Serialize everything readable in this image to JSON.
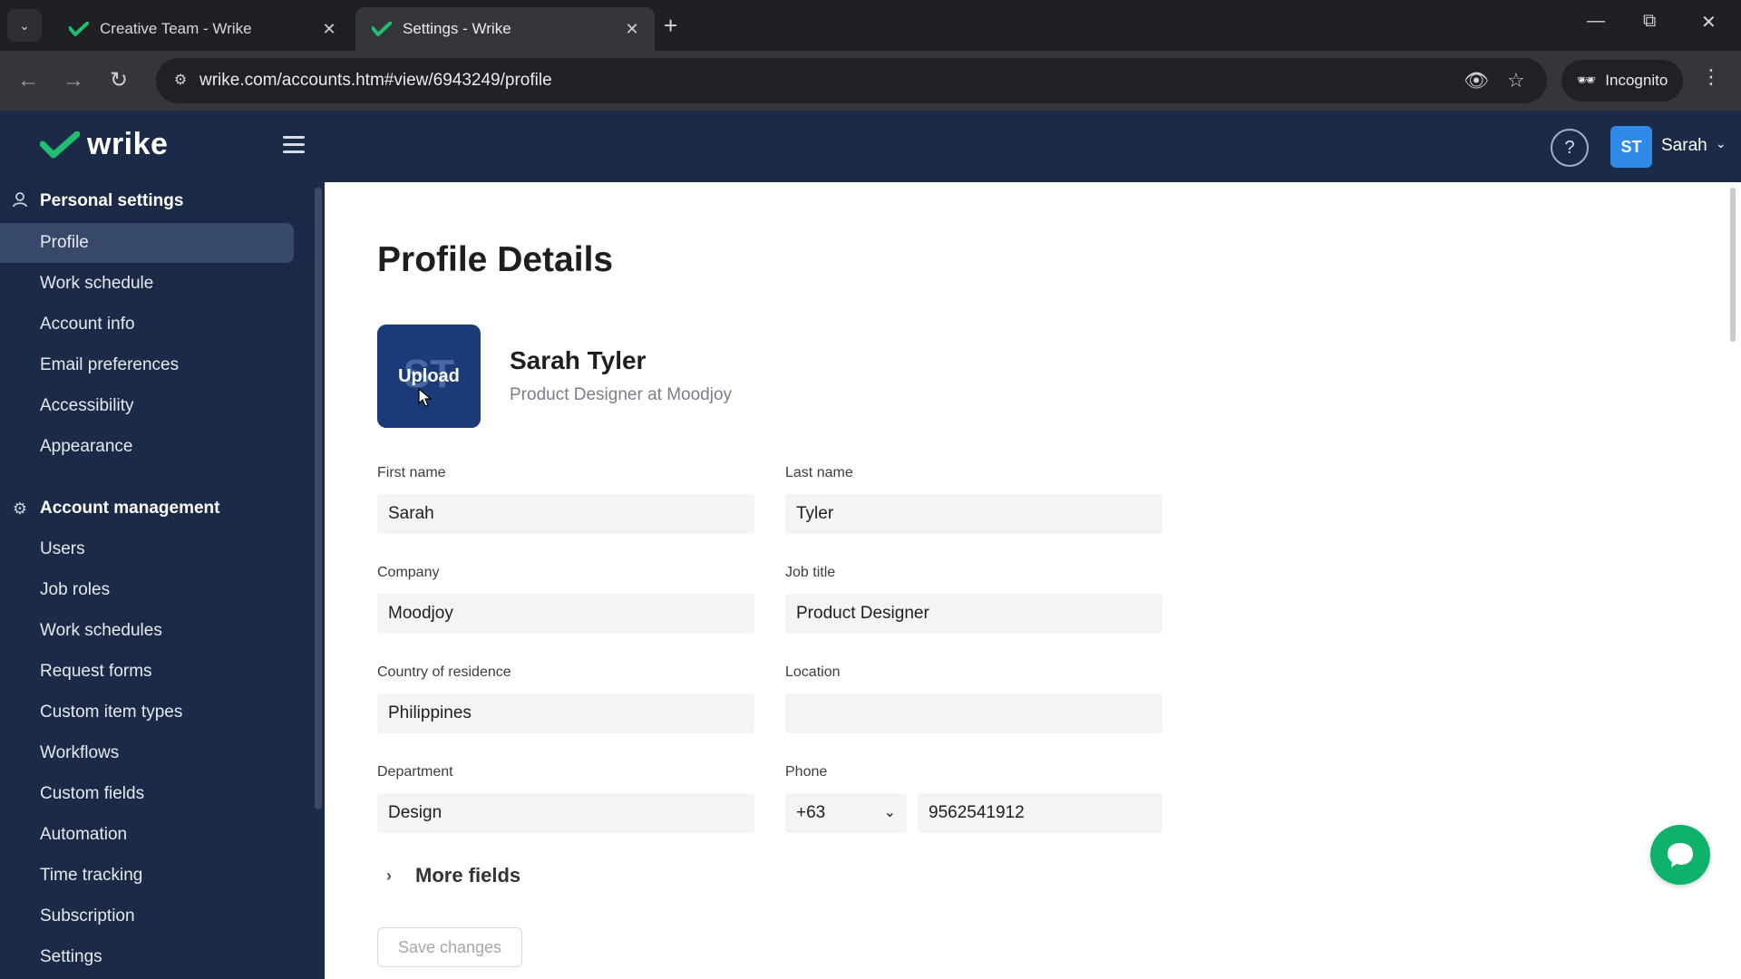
{
  "browser": {
    "tabs": [
      {
        "title": "Creative Team - Wrike",
        "active": false
      },
      {
        "title": "Settings - Wrike",
        "active": true
      }
    ],
    "url": "wrike.com/accounts.htm#view/6943249/profile",
    "incognito_label": "Incognito"
  },
  "app": {
    "logo_text": "wrike",
    "user": {
      "initials": "ST",
      "name": "Sarah"
    }
  },
  "sidebar": {
    "personal": {
      "title": "Personal settings",
      "items": [
        "Profile",
        "Work schedule",
        "Account info",
        "Email preferences",
        "Accessibility",
        "Appearance"
      ]
    },
    "account": {
      "title": "Account management",
      "items": [
        "Users",
        "Job roles",
        "Work schedules",
        "Request forms",
        "Custom item types",
        "Workflows",
        "Custom fields",
        "Automation",
        "Time tracking",
        "Subscription",
        "Settings"
      ]
    },
    "active_item": "Profile"
  },
  "profile": {
    "page_title": "Profile Details",
    "avatar_initials": "ST",
    "upload_label": "Upload",
    "full_name": "Sarah Tyler",
    "subtitle": "Product Designer at Moodjoy",
    "fields": {
      "first_name": {
        "label": "First name",
        "value": "Sarah"
      },
      "last_name": {
        "label": "Last name",
        "value": "Tyler"
      },
      "company": {
        "label": "Company",
        "value": "Moodjoy"
      },
      "job_title": {
        "label": "Job title",
        "value": "Product Designer"
      },
      "country": {
        "label": "Country of residence",
        "value": "Philippines"
      },
      "location": {
        "label": "Location",
        "value": ""
      },
      "department": {
        "label": "Department",
        "value": "Design"
      },
      "phone": {
        "label": "Phone",
        "code": "+63",
        "number": "9562541912"
      }
    },
    "more_fields_label": "More fields",
    "save_label": "Save changes"
  },
  "colors": {
    "sidebar_bg": "#1b2a47",
    "active_item_bg": "#38486a",
    "brand_green": "#0eb26a",
    "avatar_blue": "#2e8ae6"
  }
}
